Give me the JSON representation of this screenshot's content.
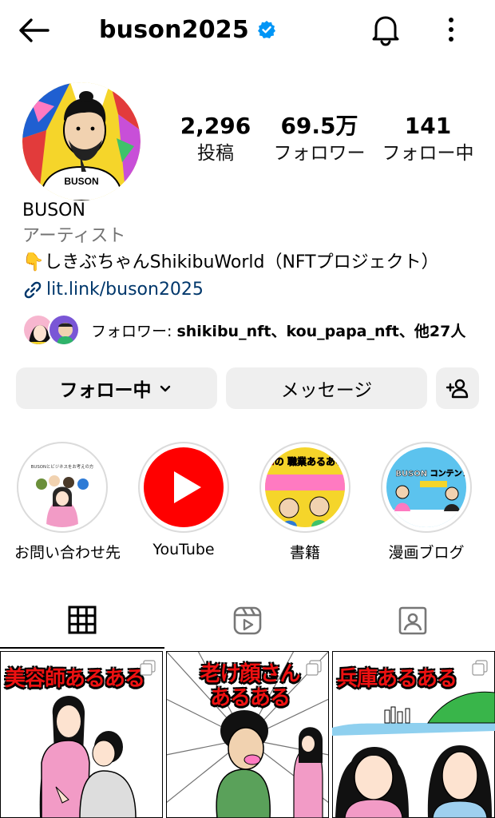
{
  "header": {
    "username": "buson2025",
    "icons": {
      "back": "back-arrow-icon",
      "verified": "verified-badge-icon",
      "bell": "bell-icon",
      "more": "more-vertical-icon"
    }
  },
  "stats": {
    "posts": {
      "value": "2,296",
      "label": "投稿"
    },
    "followers": {
      "value": "69.5万",
      "label": "フォロワー"
    },
    "following": {
      "value": "141",
      "label": "フォロー中"
    }
  },
  "bio": {
    "name": "BUSON",
    "category": "アーティスト",
    "description": "👇しきぶちゃんShikibuWorld（NFTプロジェクト）",
    "link": "lit.link/buson2025"
  },
  "followed_by": {
    "prefix": "フォロワー: ",
    "names": "shikibu_nft、kou_papa_nft、他27人"
  },
  "actions": {
    "following_label": "フォロー中",
    "message_label": "メッセージ",
    "add_user_icon": "add-user-icon"
  },
  "highlights": [
    {
      "label": "お問い合わせ先",
      "cover_text": "BUSONとビジネスをお考えの方"
    },
    {
      "label": "YouTube"
    },
    {
      "label": "書籍",
      "cover_text": "BUSONの 職業あるある大図鑑"
    },
    {
      "label": "漫画ブログ",
      "cover_text": "BUSON コンテンツ"
    }
  ],
  "tabs": [
    {
      "name": "posts",
      "icon": "grid-icon"
    },
    {
      "name": "reels",
      "icon": "reels-icon"
    },
    {
      "name": "tagged",
      "icon": "tagged-icon"
    }
  ],
  "posts": [
    {
      "title": "美容師あるある"
    },
    {
      "title": "老け顔さん あるある"
    },
    {
      "title": "兵庫あるある"
    }
  ],
  "colors": {
    "verified": "#0095f6",
    "link": "#00376b",
    "button_bg": "#efefef",
    "secondary_text": "#737373",
    "post_title": "#ee1111",
    "youtube_red": "#ff0000"
  }
}
